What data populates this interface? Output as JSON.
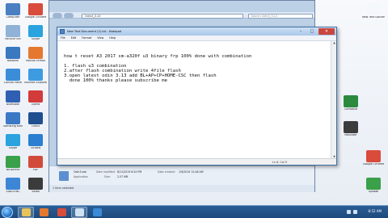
{
  "desktop": {
    "left_icons": [
      {
        "label": "Computer",
        "icon": "computer-icon",
        "color": "#4a7fc1"
      },
      {
        "label": "Google Chrome",
        "icon": "chrome-icon",
        "color": "#d94b3a"
      },
      {
        "label": "Recycle Bin",
        "icon": "recycle-bin-icon",
        "color": "#8fb2d6"
      },
      {
        "label": "Skype",
        "icon": "skype-icon",
        "color": "#2aa3df"
      },
      {
        "label": "Network",
        "icon": "network-icon",
        "color": "#3a78c0"
      },
      {
        "label": "Mozilla Firefox",
        "icon": "firefox-icon",
        "color": "#e5782f"
      },
      {
        "label": "Control Panel",
        "icon": "control-panel-icon",
        "color": "#3c8dd8"
      },
      {
        "label": "Internet Explorer",
        "icon": "ie-icon",
        "color": "#3f9be0"
      },
      {
        "label": "Bluetooth",
        "icon": "bluetooth-icon",
        "color": "#2f5fb3"
      },
      {
        "label": "Opera",
        "icon": "opera-icon",
        "color": "#d33a3a"
      },
      {
        "label": "Samsung Kies",
        "icon": "kies-icon",
        "color": "#3b79c7"
      },
      {
        "label": "Odin3",
        "icon": "odin-icon",
        "color": "#1f4f8f"
      },
      {
        "label": "Skype",
        "icon": "skype-icon-2",
        "color": "#2aa3df"
      },
      {
        "label": "3uTools",
        "icon": "tools-icon",
        "color": "#2a7fd0"
      },
      {
        "label": "BitTorrent",
        "icon": "torrent-icon",
        "color": "#3aa04a"
      },
      {
        "label": "PDF",
        "icon": "pdf-icon",
        "color": "#d24b3a"
      },
      {
        "label": "SIDESYNC",
        "icon": "sidesync-icon",
        "color": "#3d86d6"
      },
      {
        "label": "Video",
        "icon": "video-icon",
        "color": "#3b3b3b"
      }
    ],
    "right_icons": [
      {
        "label": "New Text Document",
        "icon": "text-document-icon",
        "color": "#f4f7fb"
      },
      {
        "label": "Camtasia",
        "icon": "camtasia-icon",
        "color": "#2b8a3e"
      },
      {
        "label": "Recorder",
        "icon": "recorder-icon",
        "color": "#3c3c3c"
      },
      {
        "label": "Google Chrome",
        "icon": "chrome-icon-2",
        "color": "#d94b3a"
      },
      {
        "label": "Update",
        "icon": "update-icon",
        "color": "#3aa04a"
      }
    ]
  },
  "explorer": {
    "address": "Odin3_3.13",
    "search_placeholder": "Search Odin3_3.13",
    "details": {
      "name": "Odin3.exe",
      "type": "Application",
      "date_modified_label": "Date modified:",
      "date_modified": "8/11/2019 6:20 PM",
      "size_label": "Size:",
      "size": "2.57 MB",
      "date_created_label": "Date created:",
      "date_created": "1/9/2019 12:48 AM"
    },
    "status": "1 item selected"
  },
  "notepad": {
    "title": "New Text Document (2).txt - Notepad",
    "menu": [
      "File",
      "Edit",
      "Format",
      "View",
      "Help"
    ],
    "lines": [
      "how t reset A3 2017 sm-a320f u3 binary frp 100% done with combination",
      "",
      "1. flash u3 combination",
      "2.after flash combination write 4file flash",
      "3.open latest odin 3.13 add BL+AP+CP+HOME-CSC then flash",
      "  done 100% thanks please subscribe me"
    ],
    "cursor_position": "Ln 6, Col 9"
  },
  "taskbar": {
    "clock": "8:52 AM",
    "items": [
      {
        "name": "explorer",
        "icon": "folder-icon",
        "color": "#e8c25a",
        "active": true
      },
      {
        "name": "firefox",
        "icon": "firefox-icon",
        "color": "#e5782f",
        "active": false
      },
      {
        "name": "chrome",
        "icon": "chrome-icon",
        "color": "#d94b3a",
        "active": false
      },
      {
        "name": "notepad",
        "icon": "notepad-icon",
        "color": "#cfe1f4",
        "active": true
      },
      {
        "name": "media",
        "icon": "media-player-icon",
        "color": "#3a8ad8",
        "active": false
      }
    ]
  }
}
